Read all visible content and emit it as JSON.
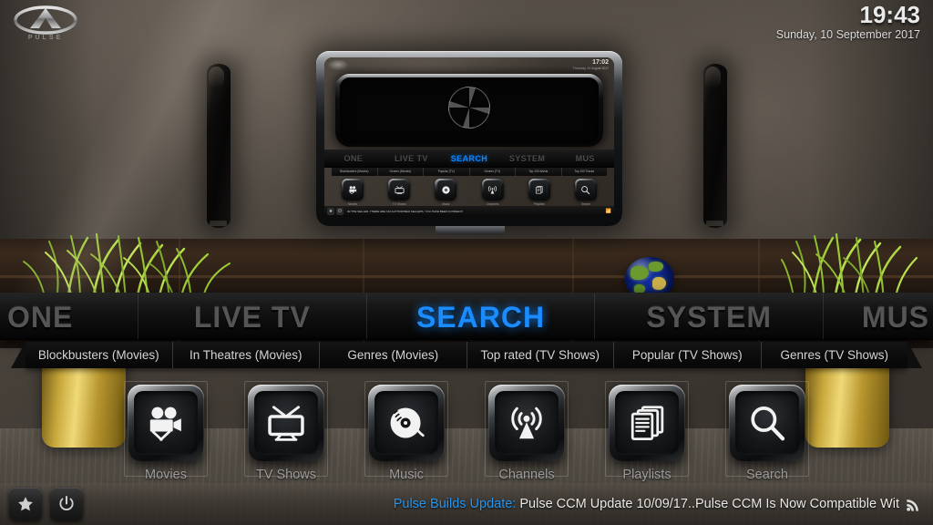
{
  "brand": {
    "name": "PULSE",
    "logo_icon": "pulse-logo-icon"
  },
  "clock": {
    "time": "19:43",
    "date": "Sunday, 10 September 2017"
  },
  "main_nav": {
    "items": [
      {
        "label": "ONE",
        "selected": false
      },
      {
        "label": "LIVE TV",
        "selected": false
      },
      {
        "label": "SEARCH",
        "selected": true
      },
      {
        "label": "SYSTEM",
        "selected": false
      },
      {
        "label": "MUS",
        "selected": false
      }
    ],
    "selected_color": "#1a8cff",
    "idle_color": "#555555"
  },
  "sub_menu": {
    "items": [
      "Blockbusters (Movies)",
      "In Theatres (Movies)",
      "Genres (Movies)",
      "Top rated (TV Shows)",
      "Popular (TV Shows)",
      "Genres (TV Shows)"
    ]
  },
  "icon_row": {
    "tiles": [
      {
        "label": "Movies",
        "icon": "film-camera-icon"
      },
      {
        "label": "TV Shows",
        "icon": "television-icon"
      },
      {
        "label": "Music",
        "icon": "vinyl-record-icon"
      },
      {
        "label": "Channels",
        "icon": "broadcast-tower-icon"
      },
      {
        "label": "Playlists",
        "icon": "stacked-documents-icon"
      },
      {
        "label": "Search",
        "icon": "magnifier-icon"
      }
    ]
  },
  "bottom_bar": {
    "favorites_icon": "star-icon",
    "power_icon": "power-icon",
    "rss_icon": "rss-icon",
    "ticker_title": "Pulse Builds Update:",
    "ticker_text": "Pulse CCM Update 10/09/17..Pulse CCM Is Now Compatible Wit"
  },
  "tv_screen": {
    "clock": {
      "time": "17:02",
      "date": "Thursday, 24 August 2017"
    },
    "nav": {
      "items": [
        {
          "label": "ONE",
          "selected": false
        },
        {
          "label": "LIVE TV",
          "selected": false
        },
        {
          "label": "SEARCH",
          "selected": true
        },
        {
          "label": "SYSTEM",
          "selected": false
        },
        {
          "label": "MUS",
          "selected": false
        }
      ]
    },
    "sub_menu": {
      "items": [
        "Blockbusters (Movies)",
        "Genres (Movies)",
        "Popular (TV)",
        "Genres (TV)",
        "Top 100 Artists",
        "Top 100 Tracks"
      ]
    },
    "tiles": [
      {
        "label": "Movies",
        "icon": "film-camera-icon"
      },
      {
        "label": "TV Shows",
        "icon": "television-icon"
      },
      {
        "label": "Music",
        "icon": "vinyl-record-icon"
      },
      {
        "label": "Channels",
        "icon": "broadcast-tower-icon"
      },
      {
        "label": "Playlists",
        "icon": "stacked-documents-icon"
      },
      {
        "label": "Search",
        "icon": "magnifier-icon"
      }
    ],
    "ticker_text": "IM THE SELLER, THERE ARE NO AUTHORISED SELLERS, YOU HAVE BEEN CONNED!!!"
  }
}
